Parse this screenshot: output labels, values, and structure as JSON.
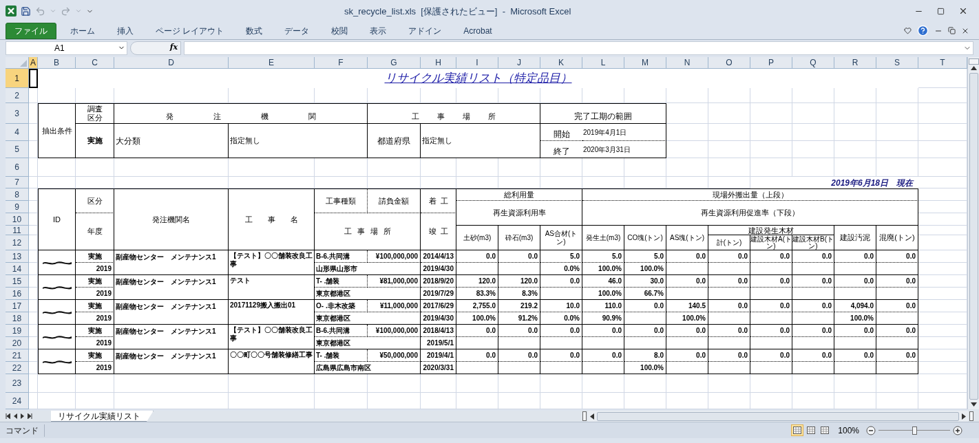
{
  "window": {
    "title": "sk_recycle_list.xls  [保護されたビュー]  -  Microsoft Excel"
  },
  "ribbon_tabs": [
    {
      "label": "ファイル",
      "kind": "file"
    },
    {
      "label": "ホーム",
      "kind": "tab"
    },
    {
      "label": "挿入",
      "kind": "tab"
    },
    {
      "label": "ページ レイアウト",
      "kind": "tab"
    },
    {
      "label": "数式",
      "kind": "tab"
    },
    {
      "label": "データ",
      "kind": "tab"
    },
    {
      "label": "校閲",
      "kind": "tab"
    },
    {
      "label": "表示",
      "kind": "tab"
    },
    {
      "label": "アドイン",
      "kind": "tab"
    },
    {
      "label": "Acrobat",
      "kind": "tab"
    }
  ],
  "formula_bar": {
    "name_box": "A1",
    "function_label": "fx"
  },
  "columns": [
    {
      "label": "A",
      "selected": true
    },
    {
      "label": "B",
      "selected": false
    },
    {
      "label": "C",
      "selected": false
    },
    {
      "label": "D",
      "selected": false
    },
    {
      "label": "E",
      "selected": false
    },
    {
      "label": "F",
      "selected": false
    },
    {
      "label": "G",
      "selected": false
    },
    {
      "label": "H",
      "selected": false
    },
    {
      "label": "I",
      "selected": false
    },
    {
      "label": "J",
      "selected": false
    },
    {
      "label": "K",
      "selected": false
    },
    {
      "label": "L",
      "selected": false
    },
    {
      "label": "M",
      "selected": false
    },
    {
      "label": "N",
      "selected": false
    },
    {
      "label": "O",
      "selected": false
    },
    {
      "label": "P",
      "selected": false
    },
    {
      "label": "Q",
      "selected": false
    },
    {
      "label": "R",
      "selected": false
    },
    {
      "label": "S",
      "selected": false
    },
    {
      "label": "T",
      "selected": false
    }
  ],
  "rows": [
    {
      "label": "1",
      "selected": true
    },
    {
      "label": "2",
      "selected": false
    },
    {
      "label": "3",
      "selected": false
    },
    {
      "label": "4",
      "selected": false
    },
    {
      "label": "5",
      "selected": false
    },
    {
      "label": "6",
      "selected": false
    },
    {
      "label": "7",
      "selected": false
    },
    {
      "label": "8",
      "selected": false
    },
    {
      "label": "9",
      "selected": false
    },
    {
      "label": "10",
      "selected": false
    },
    {
      "label": "11",
      "selected": false
    },
    {
      "label": "12",
      "selected": false
    },
    {
      "label": "13",
      "selected": false
    },
    {
      "label": "14",
      "selected": false
    },
    {
      "label": "15",
      "selected": false
    },
    {
      "label": "16",
      "selected": false
    },
    {
      "label": "17",
      "selected": false
    },
    {
      "label": "18",
      "selected": false
    },
    {
      "label": "19",
      "selected": false
    },
    {
      "label": "20",
      "selected": false
    },
    {
      "label": "21",
      "selected": false
    },
    {
      "label": "22",
      "selected": false
    },
    {
      "label": "23",
      "selected": false
    },
    {
      "label": "24",
      "selected": false
    }
  ],
  "sheet": {
    "title": "リサイクル実績リスト（特定品目）",
    "criteria": {
      "label": "抽出条件",
      "survey_header": "調査区分",
      "survey_value": "実施",
      "orderer_header": "発注機関",
      "orderer_field": "大分類",
      "orderer_value": "指定無し",
      "site_header": "工事場所",
      "site_field": "都道府県",
      "site_value": "指定無し",
      "period_header": "完了工期の範囲",
      "start_label": "開始",
      "start": "2019年4月1日",
      "end_label": "終了",
      "end": "2020年3月31日"
    },
    "as_of": "2019年6月18日　現在",
    "report": {
      "headers": {
        "id": "ID",
        "category": "区分",
        "year": "年度",
        "orderer": "発注機関名",
        "work_name": "工事名",
        "work_type": "工事種類",
        "amount": "請負金額",
        "start": "着工",
        "end": "竣工",
        "location": "工事場所",
        "total_use": "総利用量",
        "use_rate": "再生資源利用率",
        "offsite": "現場外搬出量（上段）",
        "promotion_rate": "再生資源利用促進率（下段）",
        "wood_group": "建設発生木材",
        "materials": [
          "土砂(m3)",
          "砕石(m3)",
          "AS合材(トン)",
          "発生土(m3)",
          "CO塊(トン)",
          "AS塊(トン)",
          "計(トン)",
          "建設木材A(トン)",
          "建設木材B(トン)",
          "建設汚泥",
          "混廃(トン)"
        ]
      },
      "records": [
        {
          "id_redacted": true,
          "category": "実施",
          "year": "2019",
          "orderer": "副産物センター　メンテナンス1",
          "work_name": "【テスト】〇〇舗装改良工事",
          "work_type": "B-6.共同溝",
          "amount": "¥100,000,000",
          "start": "2014/4/13",
          "location": "山形県山形市",
          "end": "2019/4/30",
          "values": [
            {
              "upper": "0.0"
            },
            {
              "upper": "0.0"
            },
            {
              "upper": "5.0",
              "lower": "0.0%"
            },
            {
              "upper": "5.0",
              "lower": "100.0%"
            },
            {
              "upper": "5.0",
              "lower": "100.0%"
            },
            {
              "upper": "0.0"
            },
            {
              "upper": "0.0"
            },
            {
              "upper": "0.0"
            },
            {
              "upper": "0.0"
            },
            {
              "upper": "0.0"
            },
            {
              "upper": "0.0"
            }
          ]
        },
        {
          "id_redacted": true,
          "category": "実施",
          "year": "2019",
          "orderer": "副産物センター　メンテナンス1",
          "work_name": "テスト",
          "work_type": "T- .舗装",
          "amount": "¥81,000,000",
          "start": "2018/9/20",
          "location": "東京都港区",
          "end": "2019/7/29",
          "values": [
            {
              "upper": "120.0",
              "lower": "83.3%"
            },
            {
              "upper": "120.0",
              "lower": "8.3%"
            },
            {
              "upper": "0.0"
            },
            {
              "upper": "46.0",
              "lower": "100.0%"
            },
            {
              "upper": "30.0",
              "lower": "66.7%"
            },
            {
              "upper": "0.0"
            },
            {
              "upper": "0.0"
            },
            {
              "upper": "0.0"
            },
            {
              "upper": "0.0"
            },
            {
              "upper": "0.0"
            },
            {
              "upper": "0.0"
            }
          ]
        },
        {
          "id_redacted": true,
          "category": "実施",
          "year": "2019",
          "orderer": "副産物センター　メンテナンス1",
          "work_name": "20171129搬入搬出01",
          "work_type": "O- .非木改築",
          "amount": "¥11,000,000",
          "start": "2017/6/29",
          "location": "東京都港区",
          "end": "2019/4/30",
          "values": [
            {
              "upper": "2,755.0",
              "lower": "100.0%"
            },
            {
              "upper": "219.2",
              "lower": "91.2%"
            },
            {
              "upper": "10.0",
              "lower": "0.0%"
            },
            {
              "upper": "110.0",
              "lower": "90.9%"
            },
            {
              "upper": "0.0"
            },
            {
              "upper": "140.5",
              "lower": "100.0%"
            },
            {
              "upper": "0.0"
            },
            {
              "upper": "0.0"
            },
            {
              "upper": "0.0"
            },
            {
              "upper": "4,094.0",
              "lower": "100.0%"
            },
            {
              "upper": "0.0"
            }
          ]
        },
        {
          "id_redacted": true,
          "category": "実施",
          "year": "2019",
          "orderer": "副産物センター　メンテナンス1",
          "work_name": "【テスト】〇〇舗装改良工事",
          "work_type": "B-6.共同溝",
          "amount": "¥100,000,000",
          "start": "2018/4/13",
          "location": "東京都港区",
          "end": "2019/5/1",
          "values": [
            {
              "upper": "0.0"
            },
            {
              "upper": "0.0"
            },
            {
              "upper": "0.0"
            },
            {
              "upper": "0.0"
            },
            {
              "upper": "0.0"
            },
            {
              "upper": "0.0"
            },
            {
              "upper": "0.0"
            },
            {
              "upper": "0.0"
            },
            {
              "upper": "0.0"
            },
            {
              "upper": "0.0"
            },
            {
              "upper": "0.0"
            }
          ]
        },
        {
          "id_redacted": true,
          "category": "実施",
          "year": "2019",
          "orderer": "副産物センター　メンテナンス1",
          "work_name": "〇〇町〇〇号舗装修繕工事",
          "work_type": "T- .舗装",
          "amount": "¥50,000,000",
          "start": "2019/4/1",
          "location": "広島県広島市南区",
          "end": "2020/3/31",
          "values": [
            {
              "upper": "0.0"
            },
            {
              "upper": "0.0"
            },
            {
              "upper": "0.0"
            },
            {
              "upper": "0.0"
            },
            {
              "upper": "8.0",
              "lower": "100.0%"
            },
            {
              "upper": "0.0"
            },
            {
              "upper": "0.0"
            },
            {
              "upper": "0.0"
            },
            {
              "upper": "0.0"
            },
            {
              "upper": "0.0"
            },
            {
              "upper": "0.0"
            }
          ]
        }
      ]
    }
  },
  "sheet_tabs": [
    {
      "label": "リサイクル実績リスト",
      "selected": true
    }
  ],
  "status_bar": {
    "mode": "コマンド",
    "view_buttons": [
      {
        "selected": true
      },
      {
        "selected": false
      },
      {
        "selected": false
      }
    ],
    "zoom": "100%",
    "zoom_slider": {
      "level": 0.5
    }
  }
}
